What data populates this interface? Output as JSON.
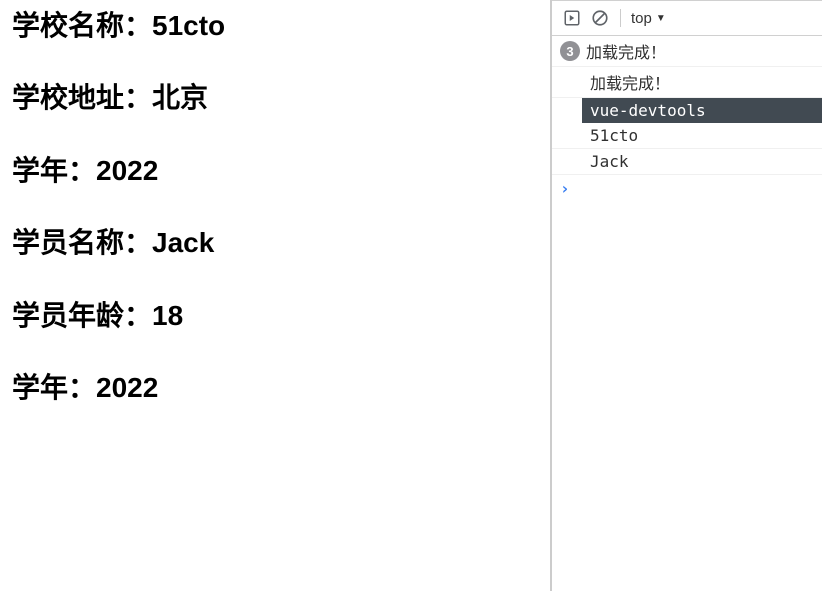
{
  "main": {
    "lines": [
      {
        "label": "学校名称：",
        "value": "51cto"
      },
      {
        "label": "学校地址：",
        "value": "北京"
      },
      {
        "label": "学年：",
        "value": "2022"
      },
      {
        "label": "学员名称：",
        "value": "Jack"
      },
      {
        "label": "学员年龄：",
        "value": "18"
      },
      {
        "label": "学年：",
        "value": "2022"
      }
    ]
  },
  "devtools": {
    "toolbar": {
      "context": "top"
    },
    "console": {
      "badge_count": "3",
      "group_text": "加载完成！",
      "rows": [
        "加载完成！",
        "vue-devtools",
        "51cto",
        "Jack"
      ]
    }
  }
}
